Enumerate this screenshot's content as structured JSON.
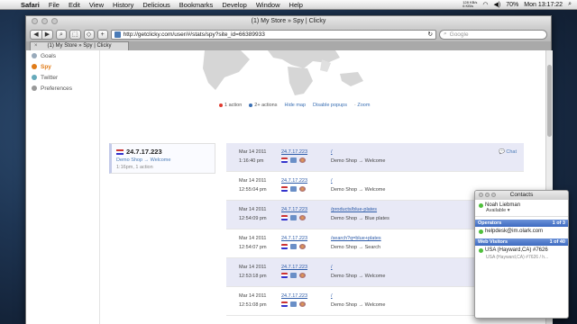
{
  "menubar": {
    "items": [
      "Safari",
      "File",
      "Edit",
      "View",
      "History",
      "Delicious",
      "Bookmarks",
      "Develop",
      "Window",
      "Help"
    ],
    "netstat": [
      "128 KB/s",
      "6 KB/s"
    ],
    "battery": "70%",
    "clock": "Mon 13:17:22"
  },
  "browser": {
    "window_title": "(1) My Store » Spy | Clicky",
    "url": "http://getclicky.com/user/#/stats/spy?site_id=66389933",
    "search_placeholder": "Google",
    "tab_label": "(1) My Store » Spy | Clicky",
    "buttons": {
      "back": "◀",
      "forward": "▶",
      "zoom": "⌕",
      "bookmark": "⬚",
      "tag": "◇",
      "add": "+"
    }
  },
  "sidebar": {
    "items": [
      {
        "label": "Goals",
        "color": "#9ab"
      },
      {
        "label": "Spy",
        "color": "#e07b18"
      },
      {
        "label": "Twitter",
        "color": "#6ab"
      },
      {
        "label": "Preferences",
        "color": "#999"
      }
    ]
  },
  "map": {
    "legend_one": "1 action",
    "legend_two": "2+ actions",
    "hide_map": "Hide map",
    "disable_popups": "Disable popups",
    "zoom": "Zoom"
  },
  "visitor": {
    "ip": "24.7.17.223",
    "site": "Demo Shop → Welcome",
    "meta": "1:16pm, 1 action"
  },
  "actions": [
    {
      "date": "Mar 14 2011",
      "time": "1:16:40 pm",
      "ip": "24.7.17.223",
      "path": "/",
      "title": "Demo Shop → Welcome",
      "chat": "Chat"
    },
    {
      "date": "Mar 14 2011",
      "time": "12:55:04 pm",
      "ip": "24.7.17.223",
      "path": "/",
      "title": "Demo Shop → Welcome"
    },
    {
      "date": "Mar 14 2011",
      "time": "12:54:09 pm",
      "ip": "24.7.17.223",
      "path": "/products/blue-plates",
      "title": "Demo Shop → Blue plates"
    },
    {
      "date": "Mar 14 2011",
      "time": "12:54:07 pm",
      "ip": "24.7.17.223",
      "path": "/search?q=blue+plates",
      "title": "Demo Shop → Search"
    },
    {
      "date": "Mar 14 2011",
      "time": "12:53:18 pm",
      "ip": "24.7.17.223",
      "path": "/",
      "title": "Demo Shop → Welcome"
    },
    {
      "date": "Mar 14 2011",
      "time": "12:51:08 pm",
      "ip": "24.7.17.223",
      "path": "/",
      "title": "Demo Shop → Welcome"
    }
  ],
  "contacts": {
    "title": "Contacts",
    "me_name": "Noah Liebman",
    "me_status": "Available ▾",
    "operators_label": "Operators",
    "operators_count": "1 of 3",
    "operator": "helpdesk@im.olark.com",
    "visitors_label": "Web Visitors",
    "visitors_count": "1 of 40",
    "visitor_name": "USA (Hayward,CA) #7626",
    "visitor_sub": "USA (Hayward,CA) #7626 / h..."
  }
}
